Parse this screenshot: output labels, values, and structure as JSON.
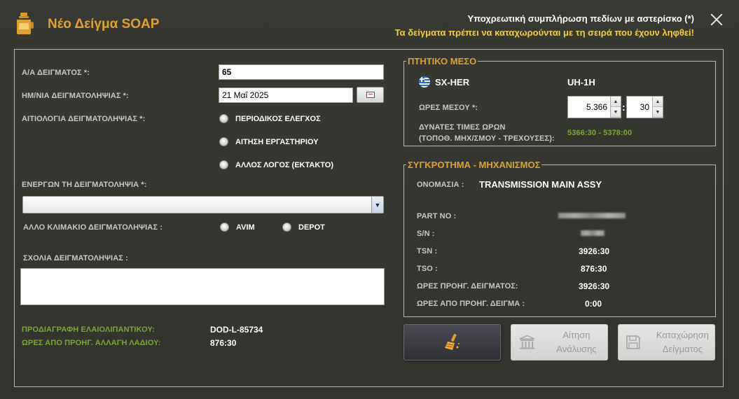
{
  "window": {
    "title": "Νέο Δείγμα SOAP",
    "notice_required": "Υποχρεωτική συμπλήρωση πεδίων με αστερίσκο (*)",
    "notice_order": "Τα δείγματα πρέπει να καταχωρούνται με τη σειρά που έχουν ληφθεί!"
  },
  "form": {
    "sample_no_label": "Α/Α ΔΕΙΓΜΑΤΟΣ *:",
    "sample_no_value": "65",
    "date_label": "ΗΜ/ΝΙΑ ΔΕΙΓΜΑΤΟΛΗΨΙΑΣ *:",
    "date_value": "21 Μαΐ 2025",
    "reason_label": "ΑΙΤΙΟΛΟΓΙΑ ΔΕΙΓΜΑΤΟΛΗΨΙΑΣ *:",
    "reason_options": [
      "ΠΕΡΙΟΔΙΚΟΣ ΕΛΕΓΧΟΣ",
      "ΑΙΤΗΣΗ ΕΡΓΑΣΤΗΡΙΟΥ",
      "ΑΛΛΟΣ ΛΟΓΟΣ (ΕΚΤΑΚΤΟ)"
    ],
    "performer_label": "ΕΝΕΡΓΩΝ ΤΗ ΔΕΙΓΜΑΤΟΛΗΨΙΑ *:",
    "performer_value": "",
    "other_level_label": "ΑΛΛΟ ΚΛΙΜΑΚΙΟ ΔΕΙΓΜΑΤΟΛΗΨΙΑΣ :",
    "other_level_options": [
      "AVIM",
      "DEPOT"
    ],
    "comments_label": "ΣΧΟΛΙΑ ΔΕΙΓΜΑΤΟΛΗΨΙΑΣ :",
    "comments_value": "",
    "lubricant_spec_label": "ΠΡΟΔΙΑΓΡΑΦΗ ΕΛΑΙΟΛΙΠΑΝΤΙΚΟΥ:",
    "lubricant_spec_value": "DOD-L-85734",
    "hours_since_oil_change_label": "ΩΡΕΣ ΑΠΟ ΠΡΟΗΓ. ΑΛΛΑΓΗ ΛΑΔΙΟΥ:",
    "hours_since_oil_change_value": "876:30"
  },
  "aircraft": {
    "group_title": "ΠΤΗΤΙΚΟ ΜΕΣΟ",
    "registration": "SX-HER",
    "type": "UH-1H",
    "hours_label": "ΩΡΕΣ ΜΕΣΟΥ *:",
    "hours_value": "5.366",
    "minutes_value": "30",
    "colon": ":",
    "possible_label_1": "ΔΥΝΑΤΕΣ ΤΙΜΕΣ ΩΡΩΝ",
    "possible_label_2": "(ΤΟΠΟΘ. ΜΗΧ/ΣΜΟΥ - ΤΡΕΧΟΥΣΕΣ):",
    "possible_value": "5366:30 - 5378:00"
  },
  "component": {
    "group_title": "ΣΥΓΚΡΟΤΗΜΑ - ΜΗΧΑΝΙΣΜΟΣ",
    "name_label": "ΟΝΟΜΑΣΙΑ :",
    "name_value": "TRANSMISSION MAIN ASSY",
    "part_no_label": "PART NO :",
    "sn_label": "S/N :",
    "tsn_label": "TSN :",
    "tsn_value": "3926:30",
    "tso_label": "TSO :",
    "tso_value": "876:30",
    "prev_sample_hours_label": "ΩΡΕΣ ΠΡΟΗΓ. ΔΕΙΓΜΑΤΟΣ:",
    "prev_sample_hours_value": "3926:30",
    "hours_since_prev_label": "ΩΡΕΣ ΑΠΟ ΠΡΟΗΓ. ΔΕΙΓΜΑ :",
    "hours_since_prev_value": "0:00"
  },
  "buttons": {
    "request_analysis_line1": "Αίτηση",
    "request_analysis_line2": "Ανάλυσης",
    "save_sample_line1": "Καταχώρηση",
    "save_sample_line2": "Δείγματος"
  },
  "colors": {
    "accent_orange": "#e0a030",
    "notice_yellow": "#f0d040",
    "label_green": "#7aa832",
    "background": "#353630"
  },
  "icons": [
    "oil-bottle-icon",
    "close-icon",
    "calendar-icon",
    "greece-flag-icon",
    "broom-icon",
    "building-icon",
    "floppy-disk-icon"
  ]
}
